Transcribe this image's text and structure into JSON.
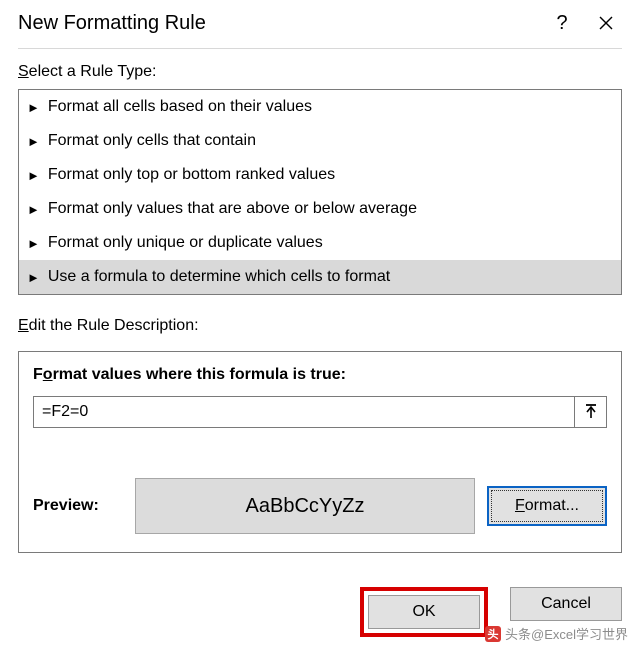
{
  "titlebar": {
    "title": "New Formatting Rule"
  },
  "ruleType": {
    "label_prefix": "S",
    "label_rest": "elect a Rule Type:",
    "items": [
      {
        "label": "Format all cells based on their values"
      },
      {
        "label": "Format only cells that contain"
      },
      {
        "label": "Format only top or bottom ranked values"
      },
      {
        "label": "Format only values that are above or below average"
      },
      {
        "label": "Format only unique or duplicate values"
      },
      {
        "label": "Use a formula to determine which cells to format"
      }
    ],
    "selected_index": 5
  },
  "editDesc": {
    "label_prefix": "E",
    "label_rest": "dit the Rule Description:",
    "group_title_before": "F",
    "group_title_ul": "o",
    "group_title_after": "rmat values where this formula is true:",
    "formula_value": "=F2=0",
    "preview_label": "Preview:",
    "preview_sample": "AaBbCcYyZz",
    "format_btn_prefix": "F",
    "format_btn_rest": "ormat..."
  },
  "buttons": {
    "ok": "OK",
    "cancel": "Cancel"
  },
  "watermark": {
    "text": "头条@Excel学习世界"
  }
}
